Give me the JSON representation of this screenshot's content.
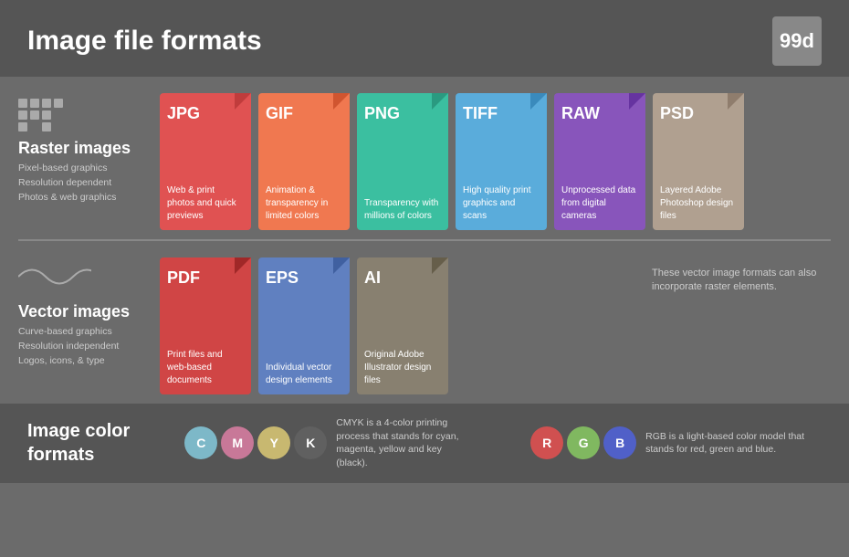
{
  "header": {
    "title": "Image file formats",
    "logo": "99d"
  },
  "raster": {
    "icon_dots": [
      true,
      true,
      true,
      true,
      true,
      true,
      true,
      false,
      true,
      false,
      true,
      false
    ],
    "title": "Raster images",
    "desc_lines": [
      "Pixel-based graphics",
      "Resolution dependent",
      "Photos & web graphics"
    ],
    "cards": [
      {
        "id": "jpg",
        "label": "JPG",
        "desc": "Web & print photos and quick previews",
        "color_class": "card-jpg",
        "fold_class": "fold-jpg"
      },
      {
        "id": "gif",
        "label": "GIF",
        "desc": "Animation & transparency in limited colors",
        "color_class": "card-gif",
        "fold_class": "fold-gif"
      },
      {
        "id": "png",
        "label": "PNG",
        "desc": "Transparency with millions of colors",
        "color_class": "card-png",
        "fold_class": "fold-png"
      },
      {
        "id": "tiff",
        "label": "TIFF",
        "desc": "High quality print graphics and scans",
        "color_class": "card-tiff",
        "fold_class": "fold-tiff"
      },
      {
        "id": "raw",
        "label": "RAW",
        "desc": "Unprocessed data from digital cameras",
        "color_class": "card-raw",
        "fold_class": "fold-raw"
      },
      {
        "id": "psd",
        "label": "PSD",
        "desc": "Layered Adobe Photoshop design files",
        "color_class": "card-psd",
        "fold_class": "fold-psd"
      }
    ]
  },
  "vector": {
    "title": "Vector images",
    "desc_lines": [
      "Curve-based graphics",
      "Resolution independent",
      "Logos, icons, & type"
    ],
    "cards": [
      {
        "id": "pdf",
        "label": "PDF",
        "desc": "Print files and web-based documents",
        "color_class": "card-pdf",
        "fold_class": "fold-pdf"
      },
      {
        "id": "eps",
        "label": "EPS",
        "desc": "Individual vector design elements",
        "color_class": "card-eps",
        "fold_class": "fold-eps"
      },
      {
        "id": "ai",
        "label": "AI",
        "desc": "Original Adobe Illustrator design files",
        "color_class": "card-ai",
        "fold_class": "fold-ai"
      }
    ],
    "note": "These vector image formats can also incorporate raster elements."
  },
  "color_formats": {
    "title": "Image color\nformats",
    "cmyk": {
      "circles": [
        {
          "letter": "C",
          "cls": "c-circle"
        },
        {
          "letter": "M",
          "cls": "m-circle"
        },
        {
          "letter": "Y",
          "cls": "y-circle"
        },
        {
          "letter": "K",
          "cls": "k-circle"
        }
      ],
      "desc": "CMYK is a 4-color printing process that stands for cyan, magenta, yellow and key (black)."
    },
    "rgb": {
      "circles": [
        {
          "letter": "R",
          "cls": "r-circle"
        },
        {
          "letter": "G",
          "cls": "g-circle"
        },
        {
          "letter": "B",
          "cls": "b-circle"
        }
      ],
      "desc": "RGB is a light-based color model that stands for red, green and blue."
    }
  }
}
